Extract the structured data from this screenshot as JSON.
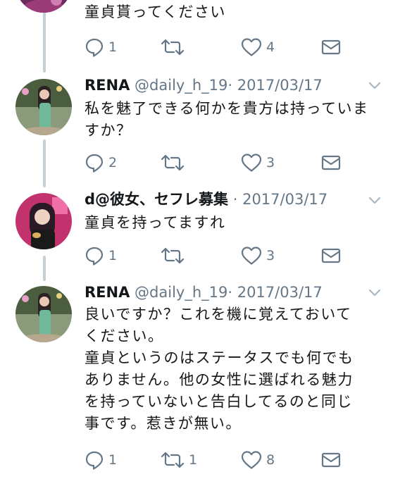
{
  "tweets": [
    {
      "text": "童貞貰ってください",
      "replies": "1",
      "retweets": "",
      "likes": "4"
    },
    {
      "name": "RENA",
      "handle": "@daily_h_19",
      "date": "· 2017/03/17",
      "text": "私を魅了できる何かを貴方は持っていますか？",
      "replies": "2",
      "retweets": "",
      "likes": "3"
    },
    {
      "name": "d@彼女、セフレ募集",
      "handle": "",
      "date": "· 2017/03/17",
      "text": "童貞を持ってますれ",
      "replies": "1",
      "retweets": "",
      "likes": "3"
    },
    {
      "name": "RENA",
      "handle": "@daily_h_19",
      "date": "· 2017/03/17",
      "text_lines": [
        "良いですか？これを機に覚えておいて",
        "ください。",
        "童貞というのはステータスでも何でも",
        "ありません。他の女性に選ばれる魅力",
        "を持っていないと告白してるのと同じ",
        "事です。惹きが無い。"
      ],
      "replies": "1",
      "retweets": "1",
      "likes": "8"
    }
  ],
  "icons": {
    "reply": "reply-icon",
    "retweet": "retweet-icon",
    "like": "heart-icon",
    "dm": "envelope-icon",
    "menu": "chevron-down-icon"
  },
  "colors": {
    "text": "#14171a",
    "secondary": "#657786",
    "thread_line": "#c4cfd6"
  }
}
